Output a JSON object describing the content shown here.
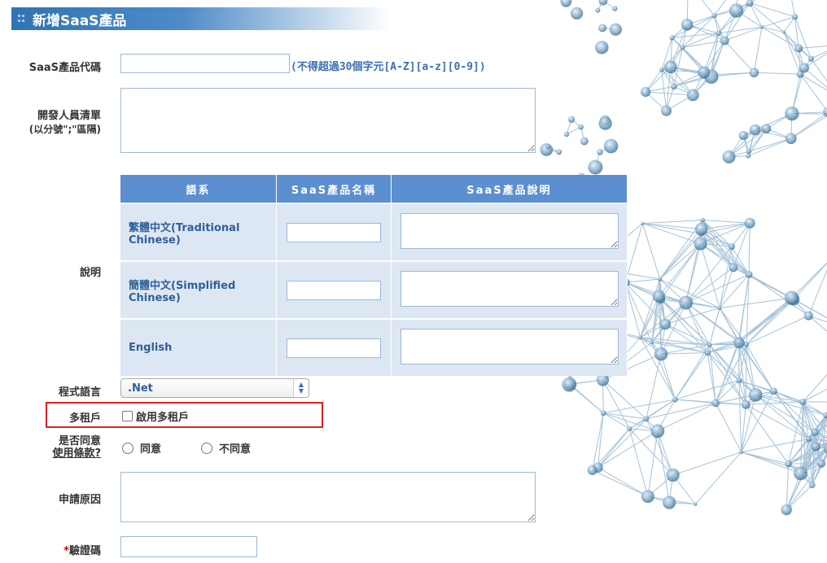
{
  "title": "新增SaaS產品",
  "fields": {
    "product_code": {
      "label": "SaaS產品代碼",
      "value": "",
      "hint": "(不得超過30個字元[A-Z][a-z][0-9])"
    },
    "developers": {
      "label_line1": "開發人員清單",
      "label_line2": "(以分號\";\"區隔)",
      "value": ""
    },
    "description": {
      "label": "說明"
    },
    "language": {
      "label": "程式語言",
      "selected": ".Net"
    },
    "multi_tenant": {
      "label": "多租戶",
      "checkbox_label": "啟用多租戶",
      "checked": false
    },
    "agree": {
      "label_line1": "是否同意",
      "label_line2": "使用條款?",
      "options": [
        "同意",
        "不同意"
      ]
    },
    "reason": {
      "label": "申請原因",
      "value": ""
    },
    "captcha": {
      "required_mark": "*",
      "label": "驗證碼",
      "value": ""
    }
  },
  "lang_table": {
    "headers": [
      "語系",
      "SaaS產品名稱",
      "SaaS產品說明"
    ],
    "rows": [
      {
        "language": "繁體中文(Traditional Chinese)",
        "name": "",
        "desc": ""
      },
      {
        "language": "簡體中文(Simplified Chinese)",
        "name": "",
        "desc": ""
      },
      {
        "language": "English",
        "name": "",
        "desc": ""
      }
    ]
  },
  "colors": {
    "accent": "#3b6fb5",
    "header": "#5b8fd0",
    "cell": "#dde7f3",
    "highlight": "#e02020"
  }
}
